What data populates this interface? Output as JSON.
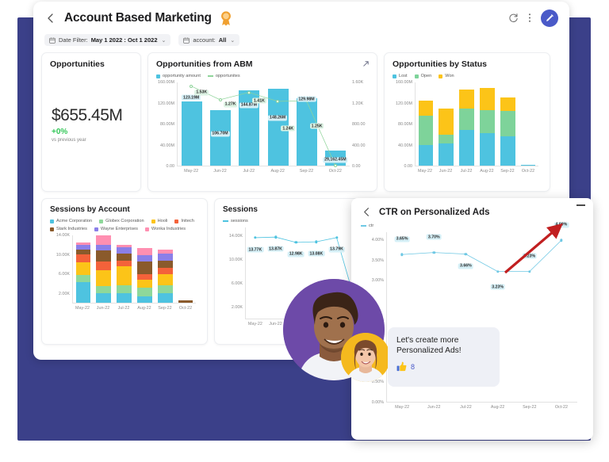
{
  "header": {
    "title": "Account Based Marketing",
    "back_icon": "back-arrow-icon",
    "badge_icon": "award-ribbon-icon",
    "refresh_icon": "refresh-icon",
    "menu_icon": "kebab-menu-icon",
    "edit_icon": "pencil-edit-icon",
    "filters": [
      {
        "label": "Date Filter:",
        "value": "May 1 2022 : Oct 1 2022",
        "caret": "⌄"
      },
      {
        "label": "account:",
        "value": "All",
        "caret": "⌄"
      }
    ]
  },
  "kpi": {
    "title": "Opportunities",
    "value": "$655.45M",
    "delta": "+0%",
    "sub": "vs previous year",
    "delta_color": "#34c759"
  },
  "cards": {
    "abm_title": "Opportunities from ABM",
    "status_title": "Opportunities by Status",
    "sessions_by_account_title": "Sessions by Account",
    "sessions_title": "Sessions",
    "ctr_title": "CTR on Personalized Ads",
    "expand_icon": "expand-arrow-icon",
    "minimize_icon": "minimize-icon",
    "ctr_back_icon": "back-arrow-icon",
    "arrow_annotation_icon": "red-trend-arrow-icon"
  },
  "chat": {
    "message": "Let's create more Personalized Ads!",
    "reaction_icon": "thumbs-up-icon",
    "reaction_count": "8",
    "avatar_large": "avatar-man",
    "avatar_small": "avatar-woman"
  },
  "chart_data": [
    {
      "id": "opportunities_from_abm",
      "type": "bar",
      "title": "Opportunities from ABM",
      "categories": [
        "May-22",
        "Jun-22",
        "Jul-22",
        "Aug-22",
        "Sep-22",
        "Oct-22"
      ],
      "series": [
        {
          "name": "opportunity amount",
          "kind": "bar",
          "color": "#4ec3e0",
          "values": [
            123.19,
            106.7,
            144.87,
            148.26,
            129.98,
            29.16
          ],
          "labels": [
            "123.19M",
            "106.70M",
            "144.87M",
            "148.26M",
            "129.98M",
            "29,162.45M"
          ],
          "axis": "left"
        },
        {
          "name": "opportunites",
          "kind": "line",
          "color": "#8fd49a",
          "values": [
            1530,
            1270,
            1410,
            1240,
            1250,
            20
          ],
          "labels": [
            "1.53K",
            "1.27K",
            "1.41K",
            "1.24K",
            "1.25K",
            ""
          ],
          "axis": "right"
        }
      ],
      "ylabel": "",
      "yticks_left": [
        "0.00",
        "40.00M",
        "80.00M",
        "120.00M",
        "160.00M"
      ],
      "yticks_right": [
        "0.00",
        "400.00",
        "800.00",
        "1.20K",
        "1.60K"
      ],
      "ylim_left": [
        0,
        160
      ],
      "ylim_right": [
        0,
        1600
      ],
      "legend_position": "top-left",
      "grid": false
    },
    {
      "id": "opportunities_by_status",
      "type": "bar",
      "title": "Opportunities by Status",
      "stacked": true,
      "categories": [
        "May-22",
        "Jun-22",
        "Jul-22",
        "Aug-22",
        "Sep-22",
        "Oct-22"
      ],
      "series": [
        {
          "name": "Lost",
          "color": "#4ec3e0",
          "values": [
            40,
            43,
            68,
            62,
            56,
            1
          ]
        },
        {
          "name": "Open",
          "color": "#7ed39a",
          "values": [
            56,
            16,
            42,
            45,
            49,
            1
          ]
        },
        {
          "name": "Won",
          "color": "#fcc418",
          "values": [
            29,
            50,
            37,
            43,
            26,
            0
          ]
        }
      ],
      "yticks": [
        "0.00",
        "40.00M",
        "80.00M",
        "120.00M",
        "160.00M"
      ],
      "ylim": [
        0,
        160
      ],
      "legend_position": "top-left",
      "grid": false
    },
    {
      "id": "sessions_by_account",
      "type": "bar",
      "title": "Sessions by Account",
      "stacked": true,
      "categories": [
        "May-22",
        "Jun-22",
        "Jul-22",
        "Aug-22",
        "Sep-22",
        "Oct-22"
      ],
      "series": [
        {
          "name": "Acme Corporation",
          "color": "#4ec3e0",
          "values": [
            4.3,
            1.9,
            2.0,
            1.4,
            2.0,
            0.0
          ]
        },
        {
          "name": "Globex Corporation",
          "color": "#8ed89a",
          "values": [
            1.5,
            1.6,
            1.6,
            1.7,
            1.6,
            0.0
          ]
        },
        {
          "name": "Hooli",
          "color": "#fcc418",
          "values": [
            2.6,
            3.3,
            4.0,
            1.7,
            2.4,
            0.0
          ]
        },
        {
          "name": "Initech",
          "color": "#f4623a",
          "values": [
            1.6,
            1.7,
            1.1,
            1.2,
            1.2,
            0.0
          ]
        },
        {
          "name": "Stark Industries",
          "color": "#8a5a2b",
          "values": [
            1.1,
            2.4,
            1.6,
            2.6,
            1.6,
            0.5
          ]
        },
        {
          "name": "Wayne Enterprises",
          "color": "#8b7fe8",
          "values": [
            1.0,
            1.2,
            1.3,
            1.3,
            1.5,
            0.0
          ]
        },
        {
          "name": "Wonka Industries",
          "color": "#ff8fb1",
          "values": [
            0.4,
            1.9,
            0.5,
            1.5,
            0.7,
            0.0
          ]
        }
      ],
      "yticks": [
        "2.00K",
        "6.00K",
        "10.00K",
        "14.00K"
      ],
      "ylim": [
        0,
        14
      ],
      "legend_position": "top-left",
      "grid": false
    },
    {
      "id": "sessions",
      "type": "line",
      "title": "Sessions",
      "categories": [
        "May-22",
        "Jun-22",
        "Jul-22",
        "Aug-22",
        "Sep-22",
        "Oct-22"
      ],
      "series": [
        {
          "name": "sessions",
          "color": "#4ec3e0",
          "values": [
            13.77,
            13.87,
            12.98,
            13.08,
            13.79,
            2.0
          ],
          "labels": [
            "13.77K",
            "13.87K",
            "12.98K",
            "13.08K",
            "13.79K",
            ""
          ]
        }
      ],
      "yticks": [
        "2.00K",
        "6.00K",
        "10.00K",
        "14.00K"
      ],
      "ylim": [
        0,
        15.5
      ],
      "legend_position": "top-left",
      "grid": false
    },
    {
      "id": "ctr_on_personalized_ads",
      "type": "line",
      "title": "CTR on Personalized Ads",
      "categories": [
        "May-22",
        "Jun-22",
        "Jul-22",
        "Aug-22",
        "Sep-22",
        "Oct-22"
      ],
      "series": [
        {
          "name": "ctr",
          "color": "#6fc8e4",
          "values": [
            3.65,
            3.7,
            3.66,
            3.23,
            3.23,
            4.0
          ],
          "labels": [
            "3.65%",
            "3.70%",
            "3.66%",
            "3.23%",
            "3.23%",
            "4.00%"
          ]
        }
      ],
      "yticks": [
        "0.00%",
        "0.50%",
        "3.00%",
        "3.50%",
        "4.00%"
      ],
      "ylim": [
        0,
        4.2
      ],
      "legend_position": "top-left",
      "grid": false
    }
  ]
}
